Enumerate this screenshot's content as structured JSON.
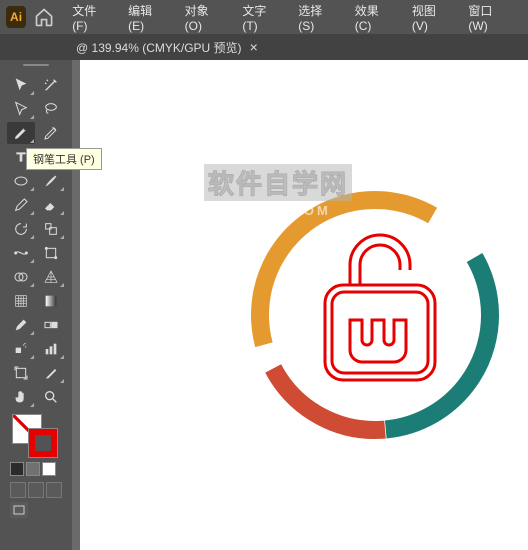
{
  "app": {
    "badge": "Ai"
  },
  "menu": [
    "文件(F)",
    "编辑(E)",
    "对象(O)",
    "文字(T)",
    "选择(S)",
    "效果(C)",
    "视图(V)",
    "窗口(W)"
  ],
  "tab": {
    "title": "@ 139.94%  (CMYK/GPU 预览)",
    "close": "×"
  },
  "tooltip": "钢笔工具 (P)",
  "watermark": {
    "line1": "软件自学网",
    "line2": "RJZXW.COM"
  },
  "colors": {
    "orange": "#e59a2f",
    "teal": "#1c7d77",
    "red": "#cf4b33",
    "stroke": "#e60000"
  },
  "swatches_row": [
    "#2b2b2b",
    "#717171",
    "#ffffff"
  ]
}
